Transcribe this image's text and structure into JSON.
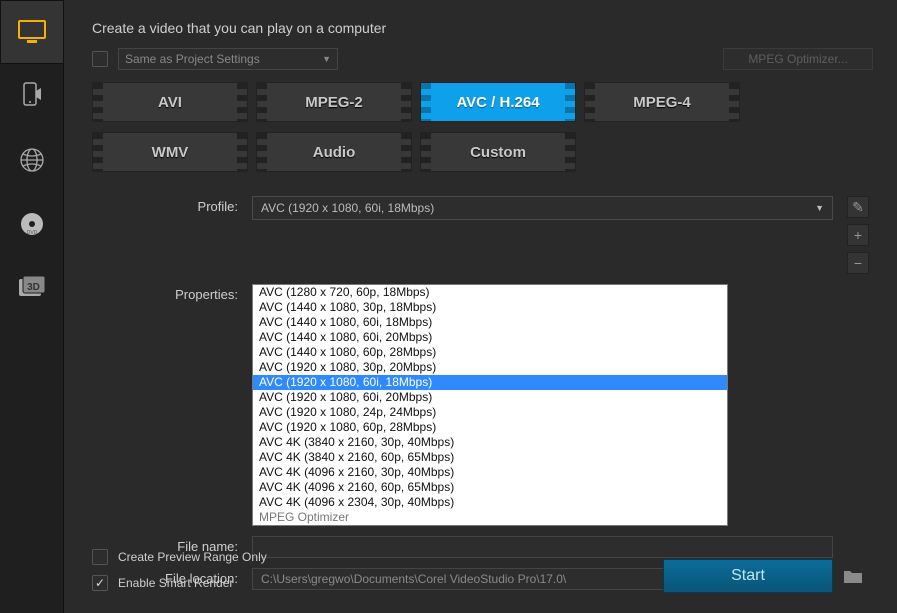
{
  "heading": "Create a video that you can play on a computer",
  "same_as_project": {
    "label": "Same as Project Settings",
    "checked": false
  },
  "optimizer_btn": "MPEG Optimizer...",
  "formats": [
    "AVI",
    "MPEG-2",
    "AVC / H.264",
    "MPEG-4",
    "WMV",
    "Audio",
    "Custom"
  ],
  "formats_selected_index": 2,
  "labels": {
    "profile": "Profile:",
    "properties": "Properties:",
    "file_name": "File name:",
    "file_location": "File location:"
  },
  "profile_selected": "AVC (1920 x 1080, 60i, 18Mbps)",
  "profile_options": [
    "AVC (1280 x 720, 60p, 18Mbps)",
    "AVC (1440 x 1080, 30p, 18Mbps)",
    "AVC (1440 x 1080, 60i, 18Mbps)",
    "AVC (1440 x 1080, 60i, 20Mbps)",
    "AVC (1440 x 1080, 60p, 28Mbps)",
    "AVC (1920 x 1080, 30p, 20Mbps)",
    "AVC (1920 x 1080, 60i, 18Mbps)",
    "AVC (1920 x 1080, 60i, 20Mbps)",
    "AVC (1920 x 1080, 24p, 24Mbps)",
    "AVC (1920 x 1080, 60p, 28Mbps)",
    "AVC 4K (3840 x 2160, 30p, 40Mbps)",
    "AVC 4K (3840 x 2160, 60p, 65Mbps)",
    "AVC 4K (4096 x 2160, 30p, 40Mbps)",
    "AVC 4K (4096 x 2160, 60p, 65Mbps)",
    "AVC 4K (4096 x 2304, 30p, 40Mbps)",
    "MPEG Optimizer"
  ],
  "profile_highlight_index": 6,
  "profile_muted_index": 15,
  "file_name": "",
  "file_location": "C:\\Users\\gregwo\\Documents\\Corel VideoStudio Pro\\17.0\\",
  "checks": {
    "preview_range": {
      "label": "Create Preview Range Only",
      "checked": false
    },
    "smart_render": {
      "label": "Enable Smart Render",
      "checked": true
    }
  },
  "start": "Start",
  "sidebar": {
    "items": [
      "computer",
      "mobile",
      "web",
      "disc",
      "3d"
    ],
    "active_index": 0
  },
  "tools": {
    "edit": "✎",
    "plus": "+",
    "minus": "−"
  },
  "badge_3d": "3D"
}
